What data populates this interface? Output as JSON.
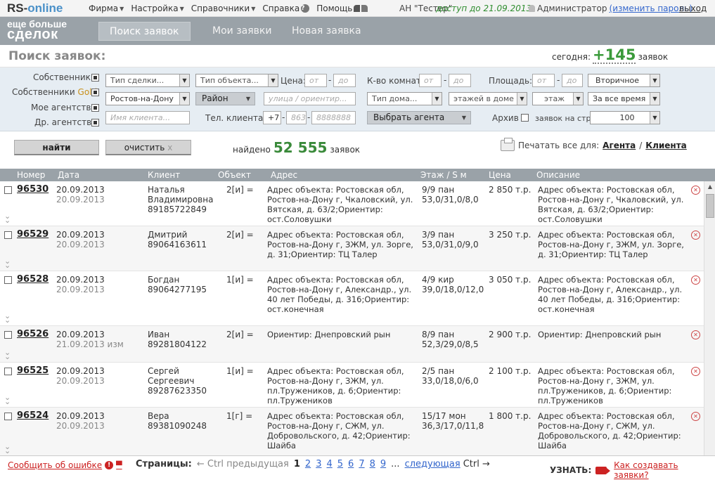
{
  "top": {
    "logo_rs": "RS-",
    "logo_online": "online",
    "menu": [
      "Фирма",
      "Настройка",
      "Справочники",
      "Справка",
      "Помощь"
    ],
    "agency": "АН \"Тестер\"",
    "access": "доступ до 21.09.2013",
    "admin": "Администратор",
    "change_password": "(изменить пароль)",
    "logout": "выход"
  },
  "nav": {
    "slogan_1": "еще больше",
    "slogan_2": "сделок",
    "tabs": [
      "Поиск заявок",
      "Мои заявки",
      "Новая заявка"
    ]
  },
  "search": {
    "title": "Поиск заявок:",
    "today_label": "сегодня:",
    "today_count": "+145",
    "today_suffix": "заявок"
  },
  "filters": {
    "owners": "Собственники",
    "owners_gold_a": "Собственники",
    "owners_gold_b": "Gold",
    "my_agency": "Мое агентство",
    "other_agencies": "Др. агентства",
    "deal_type": "Тип сделки...",
    "object_type": "Тип объекта...",
    "price": "Цена:",
    "from": "от",
    "to": "до",
    "rooms": "К-во комнат:",
    "area": "Площадь:",
    "secondary": "Вторичное",
    "city": "Ростов-на-Дону",
    "district": "Район",
    "street_placeholder": "улица / ориентир...",
    "house_type": "Тип дома...",
    "floors_in_house": "этажей в доме",
    "floor": "этаж",
    "all_time": "За все время",
    "client_name_placeholder": "Имя клиента...",
    "phone_label": "Тел. клиента:",
    "phone_code": "+7",
    "phone_area": "863",
    "phone_number": "8888888",
    "choose_agent": "Выбрать агента",
    "archive": "Архив",
    "per_page_label": "заявок на стр.:",
    "per_page": "100"
  },
  "actions": {
    "find": "найти",
    "clear": "очистить",
    "clear_x": "x",
    "found_label": "найдено",
    "found_count": "52 555",
    "found_suffix": "заявок",
    "print_label": "Печатать все для:",
    "print_agent": "Агента",
    "print_sep": "/",
    "print_client": "Клиента"
  },
  "table": {
    "headers": [
      "Номер",
      "Дата",
      "Клиент",
      "Объект",
      "Адрес",
      "Этаж / S м",
      "Цена",
      "Описание"
    ],
    "rows": [
      {
        "num": "96530",
        "date1": "20.09.2013",
        "date2": "20.09.2013",
        "client": "Наталья Владимировна 89185722849",
        "obj": "2[и] =",
        "addr": "Адрес объекта: Ростовская обл, Ростов-на-Дону г, Чкаловский, ул. Вятская, д. 63/2;Ориентир: ост.Соловушки",
        "floor": "9/9 пан 53,0/31,0/8,0",
        "price": "2 850 т.р.",
        "desc": "Адрес объекта: Ростовская обл, Ростов-на-Дону г, Чкаловский, ул. Вятская, д. 63/2;Ориентир: ост.Соловушки",
        "h": 64
      },
      {
        "num": "96529",
        "date1": "20.09.2013",
        "date2": "20.09.2013",
        "client": "Дмитрий 89064163611",
        "obj": "2[и] =",
        "addr": "Адрес объекта: Ростовская обл, Ростов-на-Дону г, ЗЖМ, ул. Зорге, д. 31;Ориентир: ТЦ Талер",
        "floor": "3/9 пан 53,0/31,0/9,0",
        "price": "3 250 т.р.",
        "desc": "Адрес объекта: Ростовская обл, Ростов-на-Дону г, ЗЖМ, ул. Зорге, д. 31;Ориентир: ТЦ Талер",
        "h": 64
      },
      {
        "num": "96528",
        "date1": "20.09.2013",
        "date2": "20.09.2013",
        "client": "Богдан 89064277195",
        "obj": "1[и] =",
        "addr": "Адрес объекта: Ростовская обл, Ростов-на-Дону г, Александр., ул. 40 лет Победы, д. 316;Ориентир: ост.конечная",
        "floor": "4/9 кир 39,0/18,0/12,0",
        "price": "3 050 т.р.",
        "desc": "Адрес объекта: Ростовская обл, Ростов-на-Дону г, Александр., ул. 40 лет Победы, д. 316;Ориентир: ост.конечная",
        "h": 78
      },
      {
        "num": "96526",
        "date1": "20.09.2013",
        "date2": "21.09.2013 изм",
        "client": "Иван 89281804122",
        "obj": "2[и] =",
        "addr": "Ориентир: Днепровский рын",
        "floor": "8/9 пан 52,3/29,0/8,5",
        "price": "2 900 т.р.",
        "desc": "Ориентир: Днепровский рын",
        "h": 52
      },
      {
        "num": "96525",
        "date1": "20.09.2013",
        "date2": "20.09.2013",
        "client": "Сергей Сергеевич 89287623350",
        "obj": "1[и] =",
        "addr": "Адрес объекта: Ростовская обл, Ростов-на-Дону г, ЗЖМ, ул. пл.Тружеников, д. 6;Ориентир: пл.Тружеников",
        "floor": "2/5 пан 33,0/18,0/6,0",
        "price": "2 100 т.р.",
        "desc": "Адрес объекта: Ростовская обл, Ростов-на-Дону г, ЗЖМ, ул. пл.Тружеников, д. 6;Ориентир: пл.Тружеников",
        "h": 64
      },
      {
        "num": "96524",
        "date1": "20.09.2013",
        "date2": "20.09.2013",
        "client": "Вера 89381090248",
        "obj": "1[г] =",
        "addr": "Адрес объекта: Ростовская обл, Ростов-на-Дону г, СЖМ, ул. Добровольского, д. 42;Ориентир: Шайба",
        "floor": "15/17 мон 36,3/17,0/11,8",
        "price": "1 800 т.р.",
        "desc": "Адрес объекта: Ростовская обл, Ростов-на-Дону г, СЖМ, ул. Добровольского, д. 42;Ориентир: Шайба",
        "h": 70
      }
    ]
  },
  "footer": {
    "report": "Сообщить об ошибке",
    "pages_label": "Страницы:",
    "prev": "← Ctrl предыдущая",
    "current": "1",
    "pages": [
      "2",
      "3",
      "4",
      "5",
      "6",
      "7",
      "8",
      "9"
    ],
    "ellipsis": "...",
    "next": "следующая",
    "next_ctrl": "Ctrl →",
    "learn": "УЗНАТЬ:",
    "howto": "Как создавать заявки?"
  }
}
